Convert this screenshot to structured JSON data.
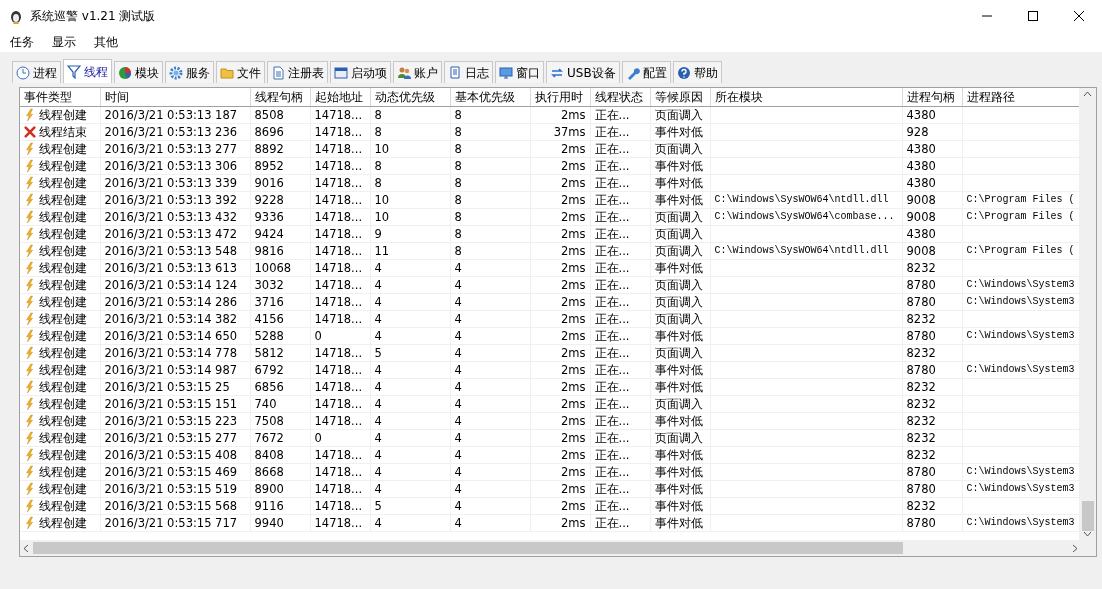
{
  "window": {
    "title": "系统巡警 v1.21 测试版"
  },
  "menu": [
    "任务",
    "显示",
    "其他"
  ],
  "tabs": [
    {
      "label": "进程",
      "selected": false
    },
    {
      "label": "线程",
      "selected": true
    },
    {
      "label": "模块",
      "selected": false
    },
    {
      "label": "服务",
      "selected": false
    },
    {
      "label": "文件",
      "selected": false
    },
    {
      "label": "注册表",
      "selected": false
    },
    {
      "label": "启动项",
      "selected": false
    },
    {
      "label": "账户",
      "selected": false
    },
    {
      "label": "日志",
      "selected": false
    },
    {
      "label": "窗口",
      "selected": false
    },
    {
      "label": "USB设备",
      "selected": false
    },
    {
      "label": "配置",
      "selected": false
    },
    {
      "label": "帮助",
      "selected": false
    }
  ],
  "table": {
    "columns": [
      "事件类型",
      "时间",
      "线程句柄",
      "起始地址",
      "动态优先级",
      "基本优先级",
      "执行用时",
      "线程状态",
      "等候原因",
      "所在模块",
      "进程句柄",
      "进程路径"
    ],
    "rows": [
      {
        "kind": "create",
        "cells": [
          "线程创建",
          "2016/3/21 0:53:13 187",
          "8508",
          "14718...",
          "8",
          "8",
          "2ms",
          "正在...",
          "页面调入",
          "",
          "4380",
          ""
        ]
      },
      {
        "kind": "end",
        "cells": [
          "线程结束",
          "2016/3/21 0:53:13 236",
          "8696",
          "14718...",
          "8",
          "8",
          "37ms",
          "正在...",
          "事件对低",
          "",
          "928",
          ""
        ]
      },
      {
        "kind": "create",
        "cells": [
          "线程创建",
          "2016/3/21 0:53:13 277",
          "8892",
          "14718...",
          "10",
          "8",
          "2ms",
          "正在...",
          "页面调入",
          "",
          "4380",
          ""
        ]
      },
      {
        "kind": "create",
        "cells": [
          "线程创建",
          "2016/3/21 0:53:13 306",
          "8952",
          "14718...",
          "8",
          "8",
          "2ms",
          "正在...",
          "事件对低",
          "",
          "4380",
          ""
        ]
      },
      {
        "kind": "create",
        "cells": [
          "线程创建",
          "2016/3/21 0:53:13 339",
          "9016",
          "14718...",
          "8",
          "8",
          "2ms",
          "正在...",
          "事件对低",
          "",
          "4380",
          ""
        ]
      },
      {
        "kind": "create",
        "cells": [
          "线程创建",
          "2016/3/21 0:53:13 392",
          "9228",
          "14718...",
          "10",
          "8",
          "2ms",
          "正在...",
          "事件对低",
          "C:\\Windows\\SysWOW64\\ntdll.dll",
          "9008",
          "C:\\Program Files ("
        ]
      },
      {
        "kind": "create",
        "cells": [
          "线程创建",
          "2016/3/21 0:53:13 432",
          "9336",
          "14718...",
          "10",
          "8",
          "2ms",
          "正在...",
          "页面调入",
          "C:\\Windows\\SysWOW64\\combase...",
          "9008",
          "C:\\Program Files ("
        ]
      },
      {
        "kind": "create",
        "cells": [
          "线程创建",
          "2016/3/21 0:53:13 472",
          "9424",
          "14718...",
          "9",
          "8",
          "2ms",
          "正在...",
          "页面调入",
          "",
          "4380",
          ""
        ]
      },
      {
        "kind": "create",
        "cells": [
          "线程创建",
          "2016/3/21 0:53:13 548",
          "9816",
          "14718...",
          "11",
          "8",
          "2ms",
          "正在...",
          "页面调入",
          "C:\\Windows\\SysWOW64\\ntdll.dll",
          "9008",
          "C:\\Program Files ("
        ]
      },
      {
        "kind": "create",
        "cells": [
          "线程创建",
          "2016/3/21 0:53:13 613",
          "10068",
          "14718...",
          "4",
          "4",
          "2ms",
          "正在...",
          "事件对低",
          "",
          "8232",
          ""
        ]
      },
      {
        "kind": "create",
        "cells": [
          "线程创建",
          "2016/3/21 0:53:14 124",
          "3032",
          "14718...",
          "4",
          "4",
          "2ms",
          "正在...",
          "页面调入",
          "",
          "8780",
          "C:\\Windows\\System3"
        ]
      },
      {
        "kind": "create",
        "cells": [
          "线程创建",
          "2016/3/21 0:53:14 286",
          "3716",
          "14718...",
          "4",
          "4",
          "2ms",
          "正在...",
          "页面调入",
          "",
          "8780",
          "C:\\Windows\\System3"
        ]
      },
      {
        "kind": "create",
        "cells": [
          "线程创建",
          "2016/3/21 0:53:14 382",
          "4156",
          "14718...",
          "4",
          "4",
          "2ms",
          "正在...",
          "页面调入",
          "",
          "8232",
          ""
        ]
      },
      {
        "kind": "create",
        "cells": [
          "线程创建",
          "2016/3/21 0:53:14 650",
          "5288",
          "0",
          "4",
          "4",
          "2ms",
          "正在...",
          "事件对低",
          "",
          "8780",
          "C:\\Windows\\System3"
        ]
      },
      {
        "kind": "create",
        "cells": [
          "线程创建",
          "2016/3/21 0:53:14 778",
          "5812",
          "14718...",
          "5",
          "4",
          "2ms",
          "正在...",
          "页面调入",
          "",
          "8232",
          ""
        ]
      },
      {
        "kind": "create",
        "cells": [
          "线程创建",
          "2016/3/21 0:53:14 987",
          "6792",
          "14718...",
          "4",
          "4",
          "2ms",
          "正在...",
          "事件对低",
          "",
          "8780",
          "C:\\Windows\\System3"
        ]
      },
      {
        "kind": "create",
        "cells": [
          "线程创建",
          "2016/3/21 0:53:15 25",
          "6856",
          "14718...",
          "4",
          "4",
          "2ms",
          "正在...",
          "事件对低",
          "",
          "8232",
          ""
        ]
      },
      {
        "kind": "create",
        "cells": [
          "线程创建",
          "2016/3/21 0:53:15 151",
          "740",
          "14718...",
          "4",
          "4",
          "2ms",
          "正在...",
          "页面调入",
          "",
          "8232",
          ""
        ]
      },
      {
        "kind": "create",
        "cells": [
          "线程创建",
          "2016/3/21 0:53:15 223",
          "7508",
          "14718...",
          "4",
          "4",
          "2ms",
          "正在...",
          "事件对低",
          "",
          "8232",
          ""
        ]
      },
      {
        "kind": "create",
        "cells": [
          "线程创建",
          "2016/3/21 0:53:15 277",
          "7672",
          "0",
          "4",
          "4",
          "2ms",
          "正在...",
          "页面调入",
          "",
          "8232",
          ""
        ]
      },
      {
        "kind": "create",
        "cells": [
          "线程创建",
          "2016/3/21 0:53:15 408",
          "8408",
          "14718...",
          "4",
          "4",
          "2ms",
          "正在...",
          "事件对低",
          "",
          "8232",
          ""
        ]
      },
      {
        "kind": "create",
        "cells": [
          "线程创建",
          "2016/3/21 0:53:15 469",
          "8668",
          "14718...",
          "4",
          "4",
          "2ms",
          "正在...",
          "事件对低",
          "",
          "8780",
          "C:\\Windows\\System3"
        ]
      },
      {
        "kind": "create",
        "cells": [
          "线程创建",
          "2016/3/21 0:53:15 519",
          "8900",
          "14718...",
          "4",
          "4",
          "2ms",
          "正在...",
          "事件对低",
          "",
          "8780",
          "C:\\Windows\\System3"
        ]
      },
      {
        "kind": "create",
        "cells": [
          "线程创建",
          "2016/3/21 0:53:15 568",
          "9116",
          "14718...",
          "5",
          "4",
          "2ms",
          "正在...",
          "事件对低",
          "",
          "8232",
          ""
        ]
      },
      {
        "kind": "create",
        "cells": [
          "线程创建",
          "2016/3/21 0:53:15 717",
          "9940",
          "14718...",
          "4",
          "4",
          "2ms",
          "正在...",
          "事件对低",
          "",
          "8780",
          "C:\\Windows\\System3"
        ]
      }
    ]
  }
}
